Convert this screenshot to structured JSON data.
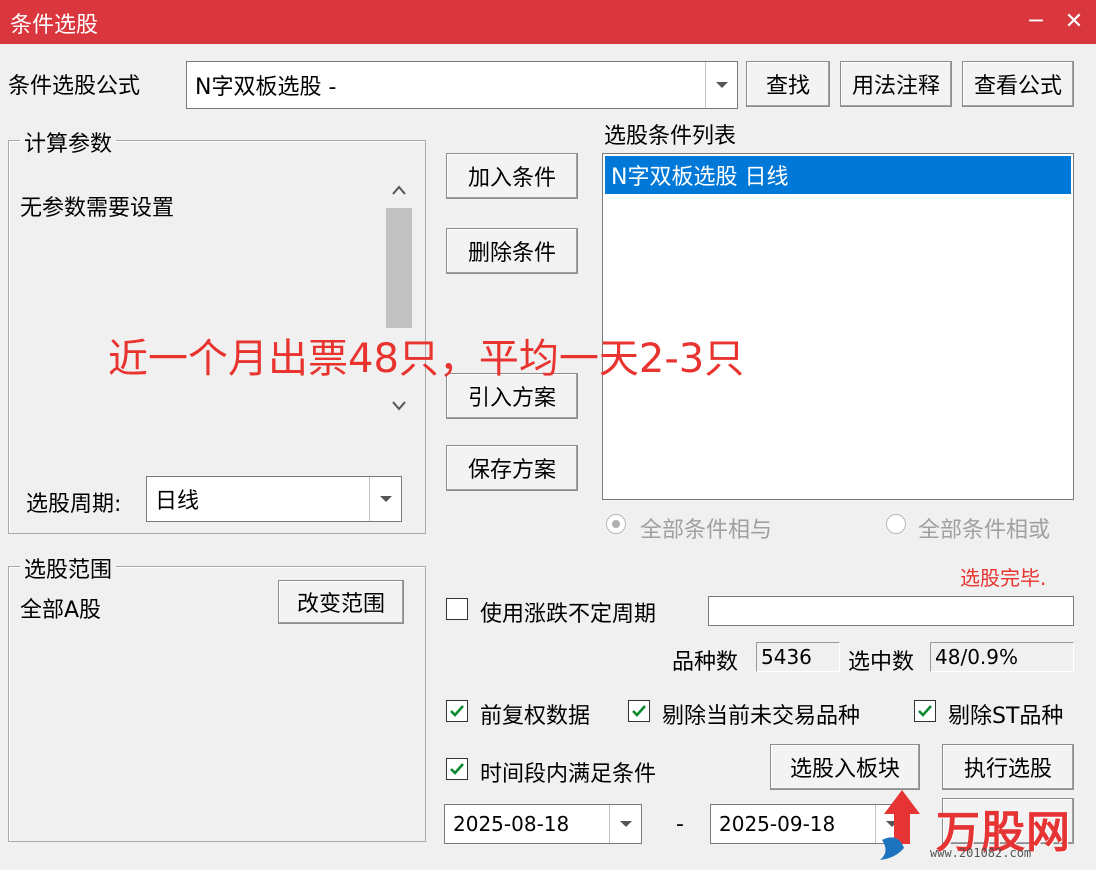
{
  "window": {
    "title": "条件选股",
    "minimize": "─",
    "close": "✕"
  },
  "formula": {
    "label": "条件选股公式",
    "value": "N字双板选股  -",
    "find_btn": "查找",
    "usage_btn": "用法注释",
    "view_btn": "查看公式"
  },
  "params": {
    "group_label": "计算参数",
    "text": "无参数需要设置",
    "period_label": "选股周期:",
    "period_value": "日线"
  },
  "actions": {
    "add": "加入条件",
    "delete": "删除条件",
    "import": "引入方案",
    "save": "保存方案"
  },
  "conditions": {
    "label": "选股条件列表",
    "items": [
      "N字双板选股  日线"
    ],
    "and_label": "全部条件相与",
    "or_label": "全部条件相或"
  },
  "overlay": {
    "text": "近一个月出票48只，平均一天2-3只"
  },
  "status": {
    "done": "选股完毕."
  },
  "scope": {
    "group_label": "选股范围",
    "value": "全部A股",
    "change_btn": "改变范围"
  },
  "options": {
    "variable_period_label": "使用涨跌不定周期",
    "variable_period_value": "",
    "count_label": "品种数",
    "count_value": "5436",
    "selected_label": "选中数",
    "selected_value": "48/0.9%",
    "adjust_label": "前复权数据",
    "exclude_untraded_label": "剔除当前未交易品种",
    "exclude_st_label": "剔除ST品种",
    "time_range_label": "时间段内满足条件",
    "to_block_btn": "选股入板块",
    "run_btn": "执行选股",
    "start_date": "2025-08-18",
    "date_sep": "-",
    "end_date": "2025-09-18"
  },
  "watermark": {
    "brand": "万股网",
    "url": "www.201082.com"
  },
  "colors": {
    "titlebar": "#d9363e",
    "selection": "#0078d7",
    "alert_text": "#e8332e",
    "check": "#0a8a2e"
  }
}
